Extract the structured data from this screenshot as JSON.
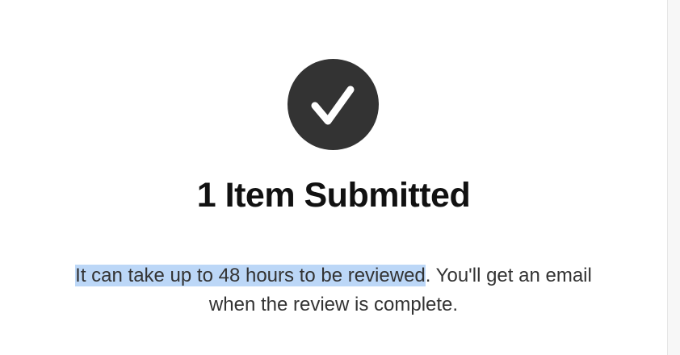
{
  "confirmation": {
    "icon": "checkmark-icon",
    "title": "1 Item Submitted",
    "message_highlighted": "It can take up to 48 hours to be reviewed",
    "message_rest_line1": ". You'll get an email",
    "message_rest_line2": "when the review is complete."
  },
  "colors": {
    "icon_background": "#333333",
    "icon_check": "#ffffff",
    "text_selection": "#bcd7f7"
  }
}
